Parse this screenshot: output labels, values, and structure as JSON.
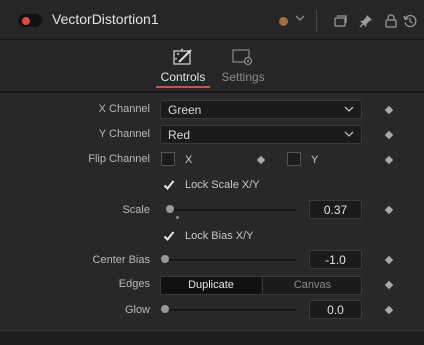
{
  "header": {
    "title": "VectorDistortion1",
    "enabled": true,
    "tile_color": "#a46b3c",
    "icons": [
      "chevron-down-icon",
      "versions-icon",
      "pin-icon",
      "lock-icon",
      "reset-icon"
    ]
  },
  "tabs": [
    {
      "label": "Controls",
      "icon": "controls-tab-icon",
      "active": true
    },
    {
      "label": "Settings",
      "icon": "settings-tab-icon",
      "active": false
    }
  ],
  "controls": {
    "x_channel": {
      "label": "X Channel",
      "value": "Green"
    },
    "y_channel": {
      "label": "Y Channel",
      "value": "Red"
    },
    "flip_channel": {
      "label": "Flip Channel",
      "x": {
        "label": "X",
        "checked": false
      },
      "y": {
        "label": "Y",
        "checked": false
      }
    },
    "lock_scale": {
      "label": "Lock Scale X/Y",
      "checked": true
    },
    "scale": {
      "label": "Scale",
      "value": "0.37"
    },
    "lock_bias": {
      "label": "Lock Bias X/Y",
      "checked": true
    },
    "center_bias": {
      "label": "Center Bias",
      "value": "-1.0"
    },
    "edges": {
      "label": "Edges",
      "options": [
        "Duplicate",
        "Canvas"
      ],
      "selected": "Duplicate"
    },
    "glow": {
      "label": "Glow",
      "value": "0.0"
    }
  },
  "colors": {
    "accent": "#d94e3b",
    "enabled_dot": "#e2473a"
  }
}
